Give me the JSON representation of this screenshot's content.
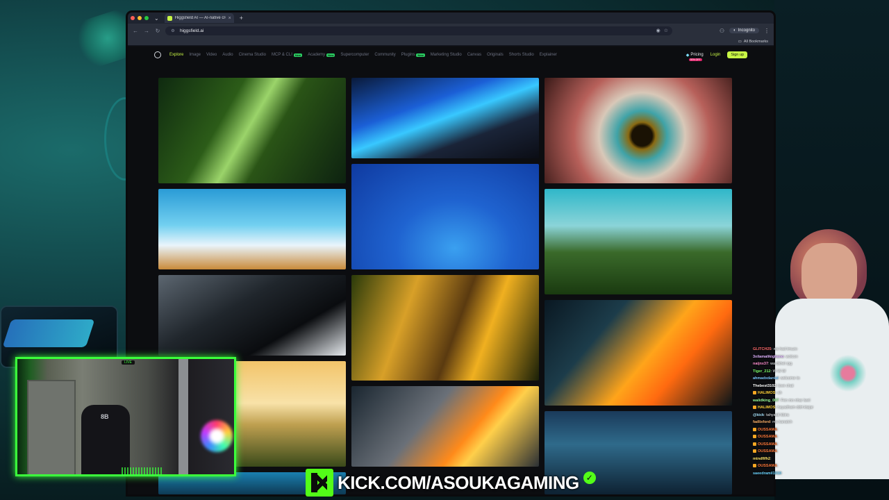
{
  "browser": {
    "tab_title": "Higgsfield AI — AI-native cre",
    "url": "higgsfield.ai",
    "incognito_label": "Incognito",
    "bookmarks_label": "All Bookmarks"
  },
  "site": {
    "nav": [
      {
        "label": "Explore",
        "active": true,
        "new": false
      },
      {
        "label": "Image",
        "new": false
      },
      {
        "label": "Video",
        "new": false
      },
      {
        "label": "Audio",
        "new": false
      },
      {
        "label": "Cinema Studio",
        "new": false
      },
      {
        "label": "MCP & CLI",
        "new": true
      },
      {
        "label": "Academy",
        "new": true
      },
      {
        "label": "Supercomputer",
        "new": false
      },
      {
        "label": "Community",
        "new": false
      },
      {
        "label": "Plugins",
        "new": true
      },
      {
        "label": "Marketing Studio",
        "new": false
      },
      {
        "label": "Canvas",
        "new": false
      },
      {
        "label": "Originals",
        "new": false
      },
      {
        "label": "Shorts Studio",
        "new": false
      },
      {
        "label": "Explainer",
        "new": false
      }
    ],
    "new_badge": "New",
    "pricing_label": "Pricing",
    "discount_label": "50% OFF",
    "login_label": "Login",
    "signup_label": "Sign up",
    "gallery": [
      {
        "name": "jungle-light-tile",
        "bg": "linear-gradient(120deg,#0f2a10 0%,#2c5c18 35%,#9bd46a 48%,#2a5416 60%,#0d2210 100%)"
      },
      {
        "name": "neon-creature-tile",
        "bg": "linear-gradient(160deg,#0a1a3a 0%,#1b5fd6 35%,#38c8ff 50%,#1a2438 70%,#0b0d15 100%)"
      },
      {
        "name": "eye-closeup-tile",
        "bg": "radial-gradient(circle at 52% 55%,#1a1204 0 9%,#8a6a12 12%,#3fa3a8 22%,#d8c8b8 38%,#b7605a 60%,#3a1a18 100%)"
      },
      {
        "name": "balloons-sky-tile",
        "bg": "linear-gradient(180deg,#2a9bd6 0%,#72d0f0 45%,#e9f4fb 70%,#c98a3a 100%)"
      },
      {
        "name": "underwater-blue-tile",
        "bg": "radial-gradient(ellipse at 55% 80%,#3aa0f0 0%,#1f63d0 40%,#0f3aa0 100%)"
      },
      {
        "name": "mushroom-meadow-tile",
        "bg": "linear-gradient(180deg,#2fb7c9 0%,#8bd4d8 35%,#3a6a2a 60%,#1a3a10 100%)"
      },
      {
        "name": "dark-rider-tile",
        "bg": "linear-gradient(150deg,#5c6670 0%,#20262c 40%,#0a0c0f 70%,#e6eaee 100%)"
      },
      {
        "name": "monkeys-tile",
        "bg": "linear-gradient(110deg,#2a3a0a 0%,#d8a028 30%,#5a3a10 55%,#f0b020 70%,#1a2008 100%)"
      },
      {
        "name": "glowing-wires-tile",
        "bg": "linear-gradient(130deg,#0a1822 0%,#1c3c4a 30%,#ffa41a 55%,#ff6a10 70%,#0b1418 100%)"
      },
      {
        "name": "sunset-lake-tile",
        "bg": "linear-gradient(180deg,#f2c46a 0%,#f8e2a8 40%,#bfa050 60%,#3a4a1a 100%)"
      },
      {
        "name": "fire-face-tile",
        "bg": "linear-gradient(130deg,#1a2630 0%,#6a7078 40%,#ff8a1a 62%,#ffcf4a 70%,#2a2f34 100%)"
      },
      {
        "name": "ice-castle-tile",
        "bg": "linear-gradient(180deg,#1a3a5a 0%,#2f6a8a 40%,#0e2232 100%)"
      },
      {
        "name": "bottom-partial-tile",
        "bg": "linear-gradient(180deg,#1a7fb0 0%,#0e3a54 100%)"
      }
    ]
  },
  "chat": [
    {
      "user": "GLITCH25",
      "text": "wa had tmuzo",
      "color": "#ff6b6b"
    },
    {
      "user": "3xilamalikighano",
      "text": "wolcon",
      "color": "#e0b3ff"
    },
    {
      "user": "naijnx37",
      "text": "wa dkhel rpg",
      "color": "#ff8fd0"
    },
    {
      "user": "Tiger_212",
      "text": "W W W",
      "color": "#7cff6b"
    },
    {
      "user": "ahmadxdanial",
      "text": "welcome to",
      "color": "#7cc8ff"
    },
    {
      "user": "Thebest3102",
      "text": "love chat",
      "color": "#ffffff"
    },
    {
      "user": "HALIMOS",
      "text": "ah",
      "color": "#ffd23b",
      "mod": true
    },
    {
      "user": "walidking_007",
      "text": "Fen mn nhar lwel",
      "color": "#9cff9c"
    },
    {
      "user": "HALIMOS",
      "text": "hayadham ddrt ktajar",
      "color": "#ffd23b",
      "mod": true
    },
    {
      "user": "@kick",
      "text": "tahyaati kbira",
      "color": "#a9e5ff"
    },
    {
      "user": "fadlixford",
      "text": "ma kanatch",
      "color": "#ffb36b"
    },
    {
      "user": "OUSSAMA",
      "text": "",
      "color": "#ff7a3b",
      "mod": true
    },
    {
      "user": "OUSSAMA",
      "text": "",
      "color": "#ff7a3b",
      "mod": true
    },
    {
      "user": "OUSSAMA",
      "text": "",
      "color": "#ff7a3b",
      "mod": true
    },
    {
      "user": "OUSSAMA",
      "text": "",
      "color": "#ff7a3b",
      "mod": true
    },
    {
      "user": "mtndfifh2",
      "text": "",
      "color": "#ffe66b"
    },
    {
      "user": "OUSSAMA",
      "text": "",
      "color": "#ff7a3b",
      "mod": true
    },
    {
      "user": "saeedramil1010",
      "text": "",
      "color": "#6bd4ff"
    }
  ],
  "webcam": {
    "live_label": "LIVE",
    "chair_logo": "8B"
  },
  "banner": {
    "text": "KICK.COM/ASOUKAGAMING",
    "brand_color": "#53fc18",
    "verified_icon": "check-icon"
  }
}
